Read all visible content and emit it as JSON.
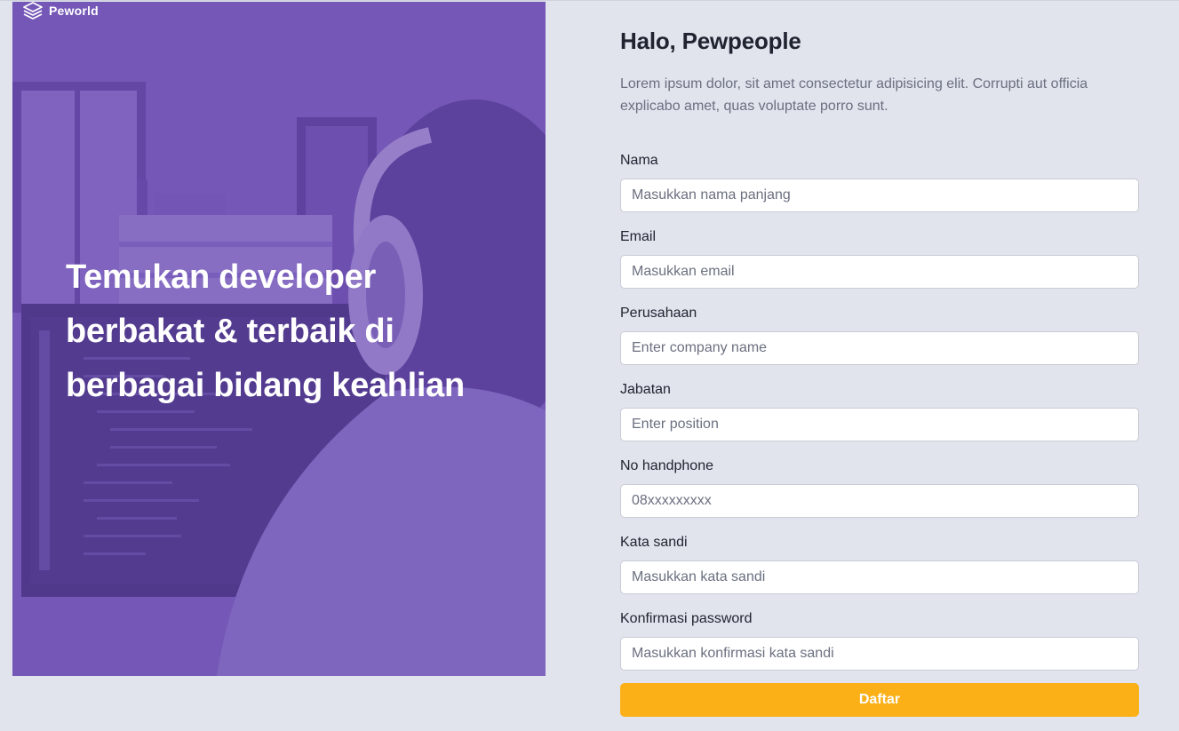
{
  "brand": {
    "name": "Peworld",
    "icon": "layers-icon"
  },
  "hero": {
    "headline": "Temukan developer berbakat & terbaik di berbagai bidang keahlian"
  },
  "form": {
    "greeting": "Halo, Pewpeople",
    "intro": "Lorem ipsum dolor, sit amet consectetur adipisicing elit. Corrupti aut officia explicabo amet, quas voluptate porro sunt.",
    "fields": [
      {
        "label": "Nama",
        "placeholder": "Masukkan nama panjang"
      },
      {
        "label": "Email",
        "placeholder": "Masukkan email"
      },
      {
        "label": "Perusahaan",
        "placeholder": "Enter company name"
      },
      {
        "label": "Jabatan",
        "placeholder": "Enter position"
      },
      {
        "label": "No handphone",
        "placeholder": "08xxxxxxxxx"
      },
      {
        "label": "Kata sandi",
        "placeholder": "Masukkan kata sandi"
      },
      {
        "label": "Konfirmasi password",
        "placeholder": "Masukkan konfirmasi kata sandi"
      }
    ],
    "submit_label": "Daftar"
  },
  "colors": {
    "page_bg": "#e1e3ed",
    "hero_tint": "#5e3aaa",
    "accent": "#fbb017"
  }
}
